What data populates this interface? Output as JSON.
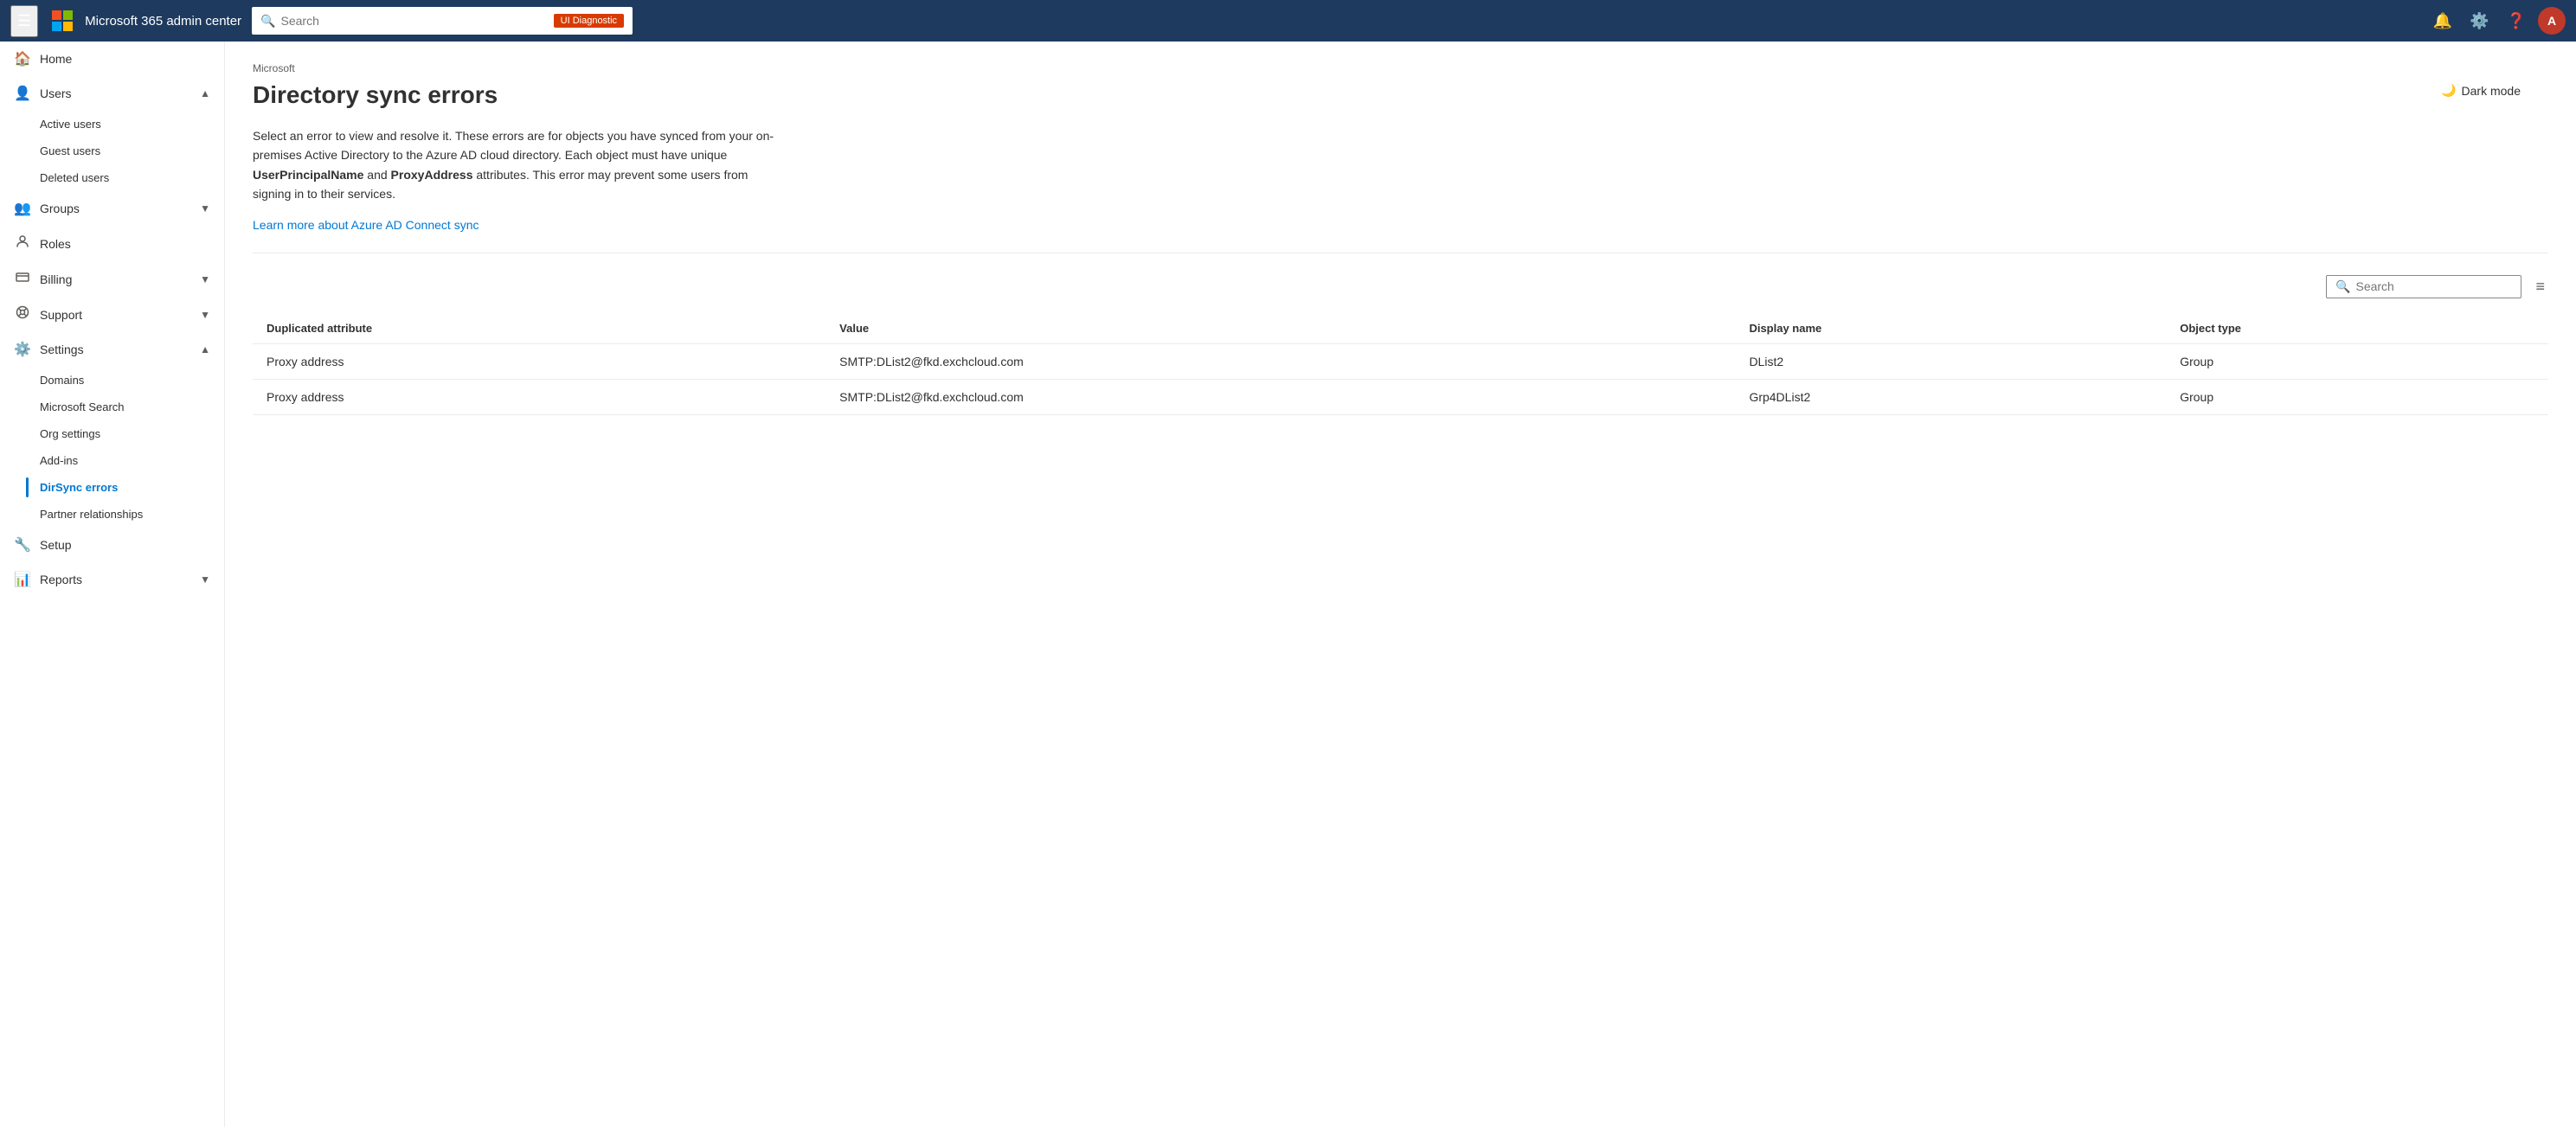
{
  "topNav": {
    "title": "Microsoft 365 admin center",
    "searchPlaceholder": "Search",
    "uiDiagnosticLabel": "UI Diagnostic",
    "avatarInitial": "A"
  },
  "darkMode": {
    "label": "Dark mode"
  },
  "sidebar": {
    "hamburgerTitle": "Collapse navigation",
    "items": [
      {
        "id": "home",
        "label": "Home",
        "icon": "🏠",
        "expandable": false
      },
      {
        "id": "users",
        "label": "Users",
        "icon": "👤",
        "expandable": true,
        "expanded": true,
        "children": [
          {
            "id": "active-users",
            "label": "Active users"
          },
          {
            "id": "guest-users",
            "label": "Guest users"
          },
          {
            "id": "deleted-users",
            "label": "Deleted users"
          }
        ]
      },
      {
        "id": "groups",
        "label": "Groups",
        "icon": "👥",
        "expandable": true,
        "expanded": false
      },
      {
        "id": "roles",
        "label": "Roles",
        "icon": "🔑",
        "expandable": false
      },
      {
        "id": "billing",
        "label": "Billing",
        "icon": "💳",
        "expandable": true,
        "expanded": false
      },
      {
        "id": "support",
        "label": "Support",
        "icon": "🎧",
        "expandable": true,
        "expanded": false
      },
      {
        "id": "settings",
        "label": "Settings",
        "icon": "⚙️",
        "expandable": true,
        "expanded": true,
        "children": [
          {
            "id": "domains",
            "label": "Domains"
          },
          {
            "id": "microsoft-search",
            "label": "Microsoft Search"
          },
          {
            "id": "org-settings",
            "label": "Org settings"
          },
          {
            "id": "add-ins",
            "label": "Add-ins"
          },
          {
            "id": "dirsync-errors",
            "label": "DirSync errors",
            "active": true
          },
          {
            "id": "partner-relationships",
            "label": "Partner relationships"
          }
        ]
      },
      {
        "id": "setup",
        "label": "Setup",
        "icon": "🔧",
        "expandable": false
      },
      {
        "id": "reports",
        "label": "Reports",
        "icon": "📊",
        "expandable": true,
        "expanded": false
      }
    ]
  },
  "content": {
    "microsoftLabel": "Microsoft",
    "pageTitle": "Directory sync errors",
    "description": "Select an error to view and resolve it. These errors are for objects you have synced from your on-premises Active Directory to the Azure AD cloud directory. Each object must have unique UserPrincipalName and ProxyAddress attributes. This error may prevent some users from signing in to their services.",
    "descriptionBold1": "UserPrincipalName",
    "descriptionBold2": "ProxyAddress",
    "learnMoreText": "Learn more about Azure AD Connect sync",
    "tableSearch": {
      "placeholder": "Search"
    },
    "tableColumns": [
      {
        "id": "duplicated-attribute",
        "label": "Duplicated attribute"
      },
      {
        "id": "value",
        "label": "Value"
      },
      {
        "id": "display-name",
        "label": "Display name"
      },
      {
        "id": "object-type",
        "label": "Object type"
      }
    ],
    "tableRows": [
      {
        "duplicatedAttribute": "Proxy address",
        "value": "SMTP:DList2@fkd.exchcloud.com",
        "displayName": "DList2",
        "objectType": "Group"
      },
      {
        "duplicatedAttribute": "Proxy address",
        "value": "SMTP:DList2@fkd.exchcloud.com",
        "displayName": "Grp4DList2",
        "objectType": "Group"
      }
    ]
  }
}
